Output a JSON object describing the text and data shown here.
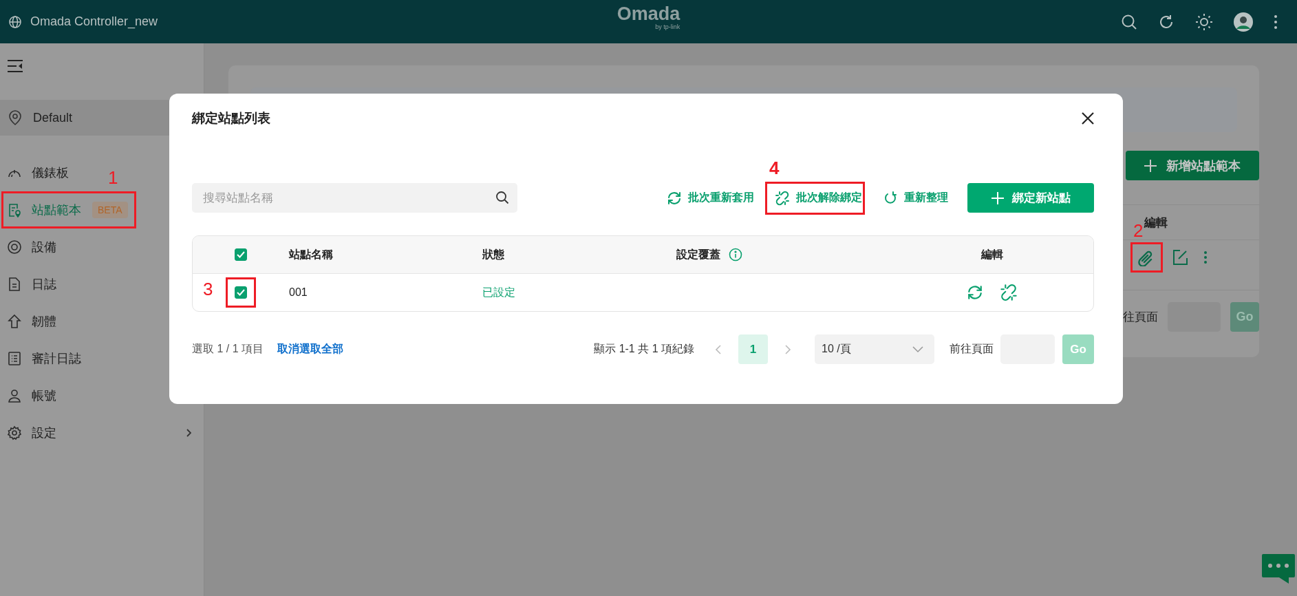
{
  "header": {
    "title": "Omada Controller_new",
    "logo": "Omada",
    "logo_tagline": "by tp-link"
  },
  "sidebar": {
    "site": "Default",
    "items": [
      {
        "label": "儀錶板",
        "selected": false
      },
      {
        "label": "站點範本",
        "selected": true,
        "badge": "BETA",
        "callout": "1"
      },
      {
        "label": "設備",
        "selected": false
      },
      {
        "label": "日誌",
        "selected": false
      },
      {
        "label": "韌體",
        "selected": false
      },
      {
        "label": "審計日誌",
        "selected": false
      },
      {
        "label": "帳號",
        "selected": false
      },
      {
        "label": "設定",
        "selected": false,
        "has_submenu": true
      }
    ]
  },
  "background": {
    "add_button": "新增站點範本",
    "edit_heading": "編輯",
    "edit_callout": "2",
    "goto_label": "往頁面",
    "go_button": "Go"
  },
  "dialog": {
    "title": "綁定站點列表",
    "search": {
      "placeholder": "搜尋站點名稱"
    },
    "actions": [
      {
        "label": "批次重新套用"
      },
      {
        "label": "批次解除綁定",
        "callout": "4"
      },
      {
        "label": "重新整理"
      }
    ],
    "primary_button": "綁定新站點",
    "table": {
      "select_all_checked": true,
      "columns": [
        "站點名稱",
        "狀態",
        "設定覆蓋",
        "編輯"
      ],
      "rows": [
        {
          "checked": true,
          "callout": "3",
          "name": "001",
          "status": "已設定"
        }
      ]
    },
    "footer": {
      "selection": "選取 1 / 1 項目",
      "clear_link": "取消選取全部",
      "summary": "顯示 1-1 共 1 項紀錄",
      "pages": [
        {
          "label": "1",
          "selected": true
        }
      ],
      "page_size": "10 /頁",
      "goto_label": "前往頁面",
      "go_button": "Go"
    }
  }
}
